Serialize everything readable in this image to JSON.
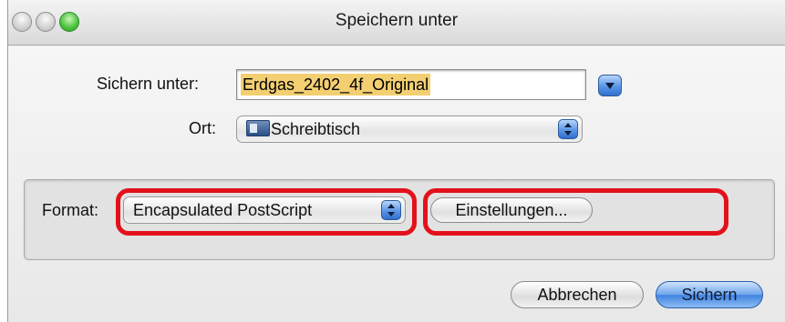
{
  "window": {
    "title": "Speichern unter"
  },
  "save_as": {
    "label": "Sichern unter:",
    "value": "Erdgas_2402_4f_Original"
  },
  "location": {
    "label": "Ort:",
    "selected": "Schreibtisch",
    "icon": "desktop-folder-icon"
  },
  "format": {
    "label": "Format:",
    "selected": "Encapsulated PostScript",
    "settings_button": "Einstellungen..."
  },
  "buttons": {
    "cancel": "Abbrechen",
    "save": "Sichern"
  },
  "colors": {
    "highlight": "#e3111b",
    "selection": "#f3cf72",
    "accent": "#3f83e0"
  }
}
